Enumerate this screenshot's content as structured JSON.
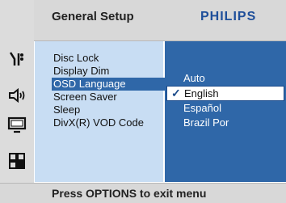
{
  "header": {
    "title": "General Setup",
    "brand": "PHILIPS"
  },
  "menu": {
    "items": [
      {
        "label": "Disc Lock"
      },
      {
        "label": "Display Dim"
      },
      {
        "label": "OSD Language",
        "selected": true
      },
      {
        "label": "Screen Saver"
      },
      {
        "label": "Sleep"
      },
      {
        "label": "DivX(R) VOD Code"
      }
    ]
  },
  "submenu": {
    "options": [
      {
        "label": "Auto"
      },
      {
        "label": "English",
        "selected": true
      },
      {
        "label": "Español"
      },
      {
        "label": "Brazil Por"
      }
    ]
  },
  "footer": {
    "hint": "Press OPTIONS to exit menu"
  },
  "sidebar": {
    "icons": [
      "settings-icon",
      "speaker-icon",
      "tv-icon",
      "grid-icon"
    ]
  },
  "colors": {
    "accent": "#2f67a8",
    "menu_bg": "#c8ddf3",
    "chrome_bg": "#d8d8d8",
    "brand": "#1f4f9a"
  }
}
